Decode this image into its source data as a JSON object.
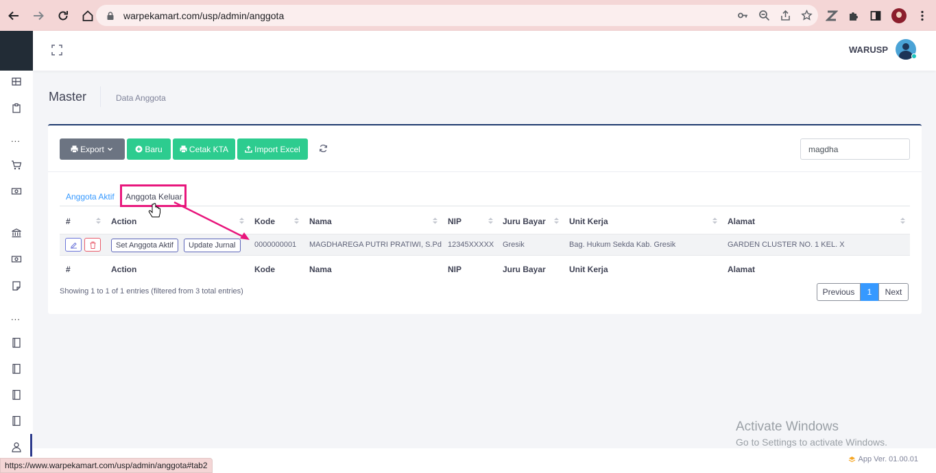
{
  "browser": {
    "url": "warpekamart.com/usp/admin/anggota",
    "status_url": "https://www.warpekamart.com/usp/admin/anggota#tab2"
  },
  "topbar": {
    "username": "WARUSP"
  },
  "subheader": {
    "title": "Master",
    "breadcrumb": "Data Anggota"
  },
  "toolbar": {
    "export_label": "Export",
    "baru_label": "Baru",
    "cetak_label": "Cetak KTA",
    "import_label": "Import Excel",
    "search_value": "magdha"
  },
  "tabs": [
    {
      "label": "Anggota Aktif"
    },
    {
      "label": "Anggota Keluar"
    }
  ],
  "table": {
    "columns": [
      "#",
      "Action",
      "Kode",
      "Nama",
      "NIP",
      "Juru Bayar",
      "Unit Kerja",
      "Alamat"
    ],
    "row": {
      "set_aktif_label": "Set Anggota Aktif",
      "update_jurnal_label": "Update Jurnal",
      "kode": "0000000001",
      "nama": "MAGDHAREGA PUTRI PRATIWI, S.Pd",
      "nip": "12345XXXXX",
      "juru_bayar": "Gresik",
      "unit_kerja": "Bag. Hukum Sekda Kab. Gresik",
      "alamat": "GARDEN CLUSTER NO. 1 KEL. X"
    },
    "info": "Showing 1 to 1 of 1 entries (filtered from 3 total entries)"
  },
  "pagination": {
    "previous": "Previous",
    "current": "1",
    "next": "Next"
  },
  "watermark": {
    "line1": "Activate Windows",
    "line2": "Go to Settings to activate Windows."
  },
  "footer": {
    "app_version": "App Ver. 01.00.01"
  },
  "colors": {
    "accent_blue": "#3699ff",
    "green_button": "#2dcc8f",
    "highlight": "#e8167c",
    "sidebar_dark": "#222c36"
  }
}
